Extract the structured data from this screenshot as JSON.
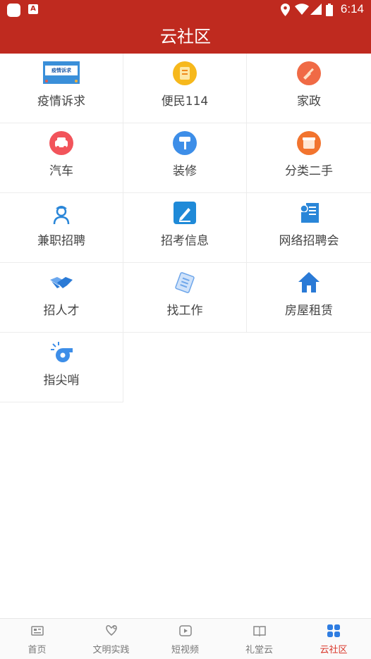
{
  "status_bar": {
    "time": "6:14"
  },
  "header": {
    "title": "云社区"
  },
  "services": [
    {
      "label": "疫情诉求",
      "icon": "epidemic-appeal-banner-icon",
      "banner_text": "疫情诉求"
    },
    {
      "label": "便民114",
      "icon": "convenience-114-icon"
    },
    {
      "label": "家政",
      "icon": "broom-housekeeping-icon"
    },
    {
      "label": "汽车",
      "icon": "car-icon"
    },
    {
      "label": "装修",
      "icon": "paint-roller-icon"
    },
    {
      "label": "分类二手",
      "icon": "secondhand-box-icon"
    },
    {
      "label": "兼职招聘",
      "icon": "worker-icon"
    },
    {
      "label": "招考信息",
      "icon": "exam-edit-icon"
    },
    {
      "label": "网络招聘会",
      "icon": "online-job-fair-icon"
    },
    {
      "label": "招人才",
      "icon": "handshake-icon"
    },
    {
      "label": "找工作",
      "icon": "document-pen-icon"
    },
    {
      "label": "房屋租赁",
      "icon": "house-icon"
    },
    {
      "label": "指尖哨",
      "icon": "whistle-icon"
    }
  ],
  "tabs": [
    {
      "label": "首页",
      "icon": "news-home-icon"
    },
    {
      "label": "文明实践",
      "icon": "heart-hands-icon"
    },
    {
      "label": "短视频",
      "icon": "play-video-icon"
    },
    {
      "label": "礼堂云",
      "icon": "book-icon"
    },
    {
      "label": "云社区",
      "icon": "grid-four-icon",
      "active": true
    }
  ],
  "colors": {
    "brand_red": "#bf2a1f",
    "active_tab": "#d9382c",
    "active_icon": "#2f7de1"
  }
}
